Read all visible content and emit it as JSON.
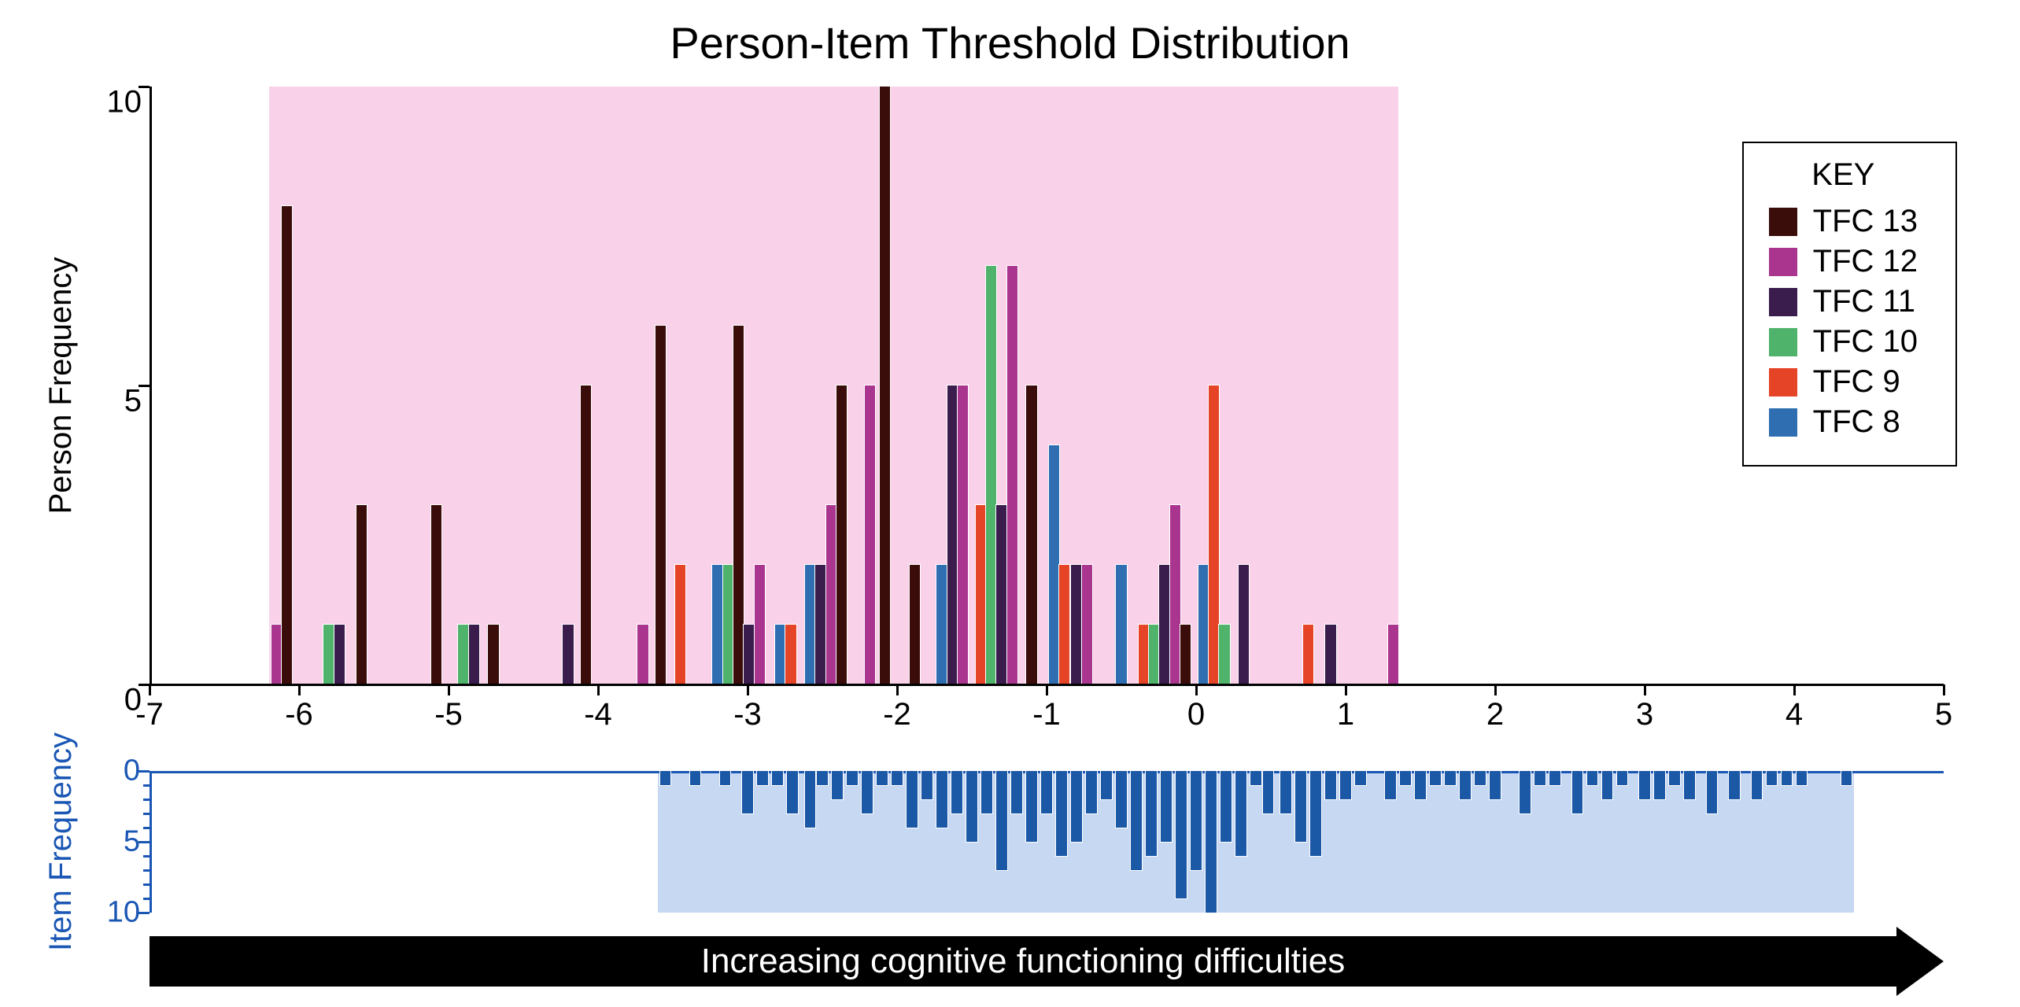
{
  "chart_data": {
    "type": "bar",
    "title": "Person-Item Threshold Distribution",
    "x_axis": {
      "range": [
        -7,
        5
      ],
      "ticks": [
        -7,
        -6,
        -5,
        -4,
        -3,
        -2,
        -1,
        0,
        1,
        2,
        3,
        4,
        5
      ]
    },
    "upper": {
      "ylabel": "Person Frequency",
      "ylim": [
        0,
        10
      ],
      "yticks": [
        0,
        5,
        10
      ],
      "pink_band_range": [
        -6.2,
        1.35
      ],
      "series": [
        {
          "name": "TFC 13",
          "color": "#3b0d0a"
        },
        {
          "name": "TFC 12",
          "color": "#a9358f"
        },
        {
          "name": "TFC 11",
          "color": "#3b1d4d"
        },
        {
          "name": "TFC 10",
          "color": "#4fb36c"
        },
        {
          "name": "TFC 9",
          "color": "#e64427"
        },
        {
          "name": "TFC 8",
          "color": "#2f6fb1"
        }
      ],
      "bar_width": 0.07,
      "bars": [
        {
          "x": -6.15,
          "y": 1,
          "series": "TFC 12"
        },
        {
          "x": -6.08,
          "y": 8,
          "series": "TFC 13"
        },
        {
          "x": -5.8,
          "y": 1,
          "series": "TFC 10"
        },
        {
          "x": -5.73,
          "y": 1,
          "series": "TFC 11"
        },
        {
          "x": -5.58,
          "y": 3,
          "series": "TFC 13"
        },
        {
          "x": -5.08,
          "y": 3,
          "series": "TFC 13"
        },
        {
          "x": -4.9,
          "y": 1,
          "series": "TFC 10"
        },
        {
          "x": -4.83,
          "y": 1,
          "series": "TFC 11"
        },
        {
          "x": -4.7,
          "y": 1,
          "series": "TFC 13"
        },
        {
          "x": -4.2,
          "y": 1,
          "series": "TFC 11"
        },
        {
          "x": -4.08,
          "y": 5,
          "series": "TFC 13"
        },
        {
          "x": -3.7,
          "y": 1,
          "series": "TFC 12"
        },
        {
          "x": -3.58,
          "y": 6,
          "series": "TFC 13"
        },
        {
          "x": -3.45,
          "y": 2,
          "series": "TFC 9"
        },
        {
          "x": -3.2,
          "y": 2,
          "series": "TFC 8"
        },
        {
          "x": -3.13,
          "y": 2,
          "series": "TFC 10"
        },
        {
          "x": -3.06,
          "y": 6,
          "series": "TFC 13"
        },
        {
          "x": -2.99,
          "y": 1,
          "series": "TFC 11"
        },
        {
          "x": -2.92,
          "y": 2,
          "series": "TFC 12"
        },
        {
          "x": -2.78,
          "y": 1,
          "series": "TFC 8"
        },
        {
          "x": -2.71,
          "y": 1,
          "series": "TFC 9"
        },
        {
          "x": -2.58,
          "y": 2,
          "series": "TFC 8"
        },
        {
          "x": -2.51,
          "y": 2,
          "series": "TFC 11"
        },
        {
          "x": -2.44,
          "y": 3,
          "series": "TFC 12"
        },
        {
          "x": -2.37,
          "y": 5,
          "series": "TFC 13"
        },
        {
          "x": -2.18,
          "y": 5,
          "series": "TFC 12"
        },
        {
          "x": -2.08,
          "y": 10,
          "series": "TFC 13"
        },
        {
          "x": -1.88,
          "y": 2,
          "series": "TFC 13"
        },
        {
          "x": -1.7,
          "y": 2,
          "series": "TFC 8"
        },
        {
          "x": -1.63,
          "y": 5,
          "series": "TFC 11"
        },
        {
          "x": -1.56,
          "y": 5,
          "series": "TFC 12"
        },
        {
          "x": -1.44,
          "y": 3,
          "series": "TFC 9"
        },
        {
          "x": -1.37,
          "y": 7,
          "series": "TFC 10"
        },
        {
          "x": -1.3,
          "y": 3,
          "series": "TFC 11"
        },
        {
          "x": -1.23,
          "y": 7,
          "series": "TFC 12"
        },
        {
          "x": -1.1,
          "y": 5,
          "series": "TFC 13"
        },
        {
          "x": -0.95,
          "y": 4,
          "series": "TFC 8"
        },
        {
          "x": -0.88,
          "y": 2,
          "series": "TFC 9"
        },
        {
          "x": -0.8,
          "y": 2,
          "series": "TFC 11"
        },
        {
          "x": -0.73,
          "y": 2,
          "series": "TFC 12"
        },
        {
          "x": -0.5,
          "y": 2,
          "series": "TFC 8"
        },
        {
          "x": -0.35,
          "y": 1,
          "series": "TFC 9"
        },
        {
          "x": -0.28,
          "y": 1,
          "series": "TFC 10"
        },
        {
          "x": -0.21,
          "y": 2,
          "series": "TFC 11"
        },
        {
          "x": -0.14,
          "y": 3,
          "series": "TFC 12"
        },
        {
          "x": -0.07,
          "y": 1,
          "series": "TFC 13"
        },
        {
          "x": 0.05,
          "y": 2,
          "series": "TFC 8"
        },
        {
          "x": 0.12,
          "y": 5,
          "series": "TFC 9"
        },
        {
          "x": 0.19,
          "y": 1,
          "series": "TFC 10"
        },
        {
          "x": 0.32,
          "y": 2,
          "series": "TFC 11"
        },
        {
          "x": 0.75,
          "y": 1,
          "series": "TFC 9"
        },
        {
          "x": 0.9,
          "y": 1,
          "series": "TFC 11"
        },
        {
          "x": 1.32,
          "y": 1,
          "series": "TFC 12"
        }
      ]
    },
    "lower": {
      "ylabel": "Item Frequency",
      "ylim": [
        0,
        10
      ],
      "yticks": [
        0,
        5,
        10
      ],
      "blue_band_range": [
        -3.6,
        4.4
      ],
      "bar_color": "#1b58a6",
      "bar_width": 0.07,
      "bars": [
        {
          "x": -3.55,
          "y": 1
        },
        {
          "x": -3.35,
          "y": 1
        },
        {
          "x": -3.15,
          "y": 1
        },
        {
          "x": -3.0,
          "y": 3
        },
        {
          "x": -2.9,
          "y": 1
        },
        {
          "x": -2.8,
          "y": 1
        },
        {
          "x": -2.7,
          "y": 3
        },
        {
          "x": -2.58,
          "y": 4
        },
        {
          "x": -2.5,
          "y": 1
        },
        {
          "x": -2.4,
          "y": 2
        },
        {
          "x": -2.3,
          "y": 1
        },
        {
          "x": -2.2,
          "y": 3
        },
        {
          "x": -2.1,
          "y": 1
        },
        {
          "x": -2.0,
          "y": 1
        },
        {
          "x": -1.9,
          "y": 4
        },
        {
          "x": -1.8,
          "y": 2
        },
        {
          "x": -1.7,
          "y": 4
        },
        {
          "x": -1.6,
          "y": 3
        },
        {
          "x": -1.5,
          "y": 5
        },
        {
          "x": -1.4,
          "y": 3
        },
        {
          "x": -1.3,
          "y": 7
        },
        {
          "x": -1.2,
          "y": 3
        },
        {
          "x": -1.1,
          "y": 5
        },
        {
          "x": -1.0,
          "y": 3
        },
        {
          "x": -0.9,
          "y": 6
        },
        {
          "x": -0.8,
          "y": 5
        },
        {
          "x": -0.7,
          "y": 3
        },
        {
          "x": -0.6,
          "y": 2
        },
        {
          "x": -0.5,
          "y": 4
        },
        {
          "x": -0.4,
          "y": 7
        },
        {
          "x": -0.3,
          "y": 6
        },
        {
          "x": -0.2,
          "y": 5
        },
        {
          "x": -0.1,
          "y": 9
        },
        {
          "x": 0.0,
          "y": 7
        },
        {
          "x": 0.1,
          "y": 11
        },
        {
          "x": 0.2,
          "y": 5
        },
        {
          "x": 0.3,
          "y": 6
        },
        {
          "x": 0.4,
          "y": 1
        },
        {
          "x": 0.48,
          "y": 3
        },
        {
          "x": 0.6,
          "y": 3
        },
        {
          "x": 0.7,
          "y": 5
        },
        {
          "x": 0.8,
          "y": 6
        },
        {
          "x": 0.9,
          "y": 2
        },
        {
          "x": 1.0,
          "y": 2
        },
        {
          "x": 1.1,
          "y": 1
        },
        {
          "x": 1.3,
          "y": 2
        },
        {
          "x": 1.4,
          "y": 1
        },
        {
          "x": 1.5,
          "y": 2
        },
        {
          "x": 1.6,
          "y": 1
        },
        {
          "x": 1.7,
          "y": 1
        },
        {
          "x": 1.8,
          "y": 2
        },
        {
          "x": 1.9,
          "y": 1
        },
        {
          "x": 2.0,
          "y": 2
        },
        {
          "x": 2.2,
          "y": 3
        },
        {
          "x": 2.3,
          "y": 1
        },
        {
          "x": 2.4,
          "y": 1
        },
        {
          "x": 2.55,
          "y": 3
        },
        {
          "x": 2.65,
          "y": 1
        },
        {
          "x": 2.75,
          "y": 2
        },
        {
          "x": 2.85,
          "y": 1
        },
        {
          "x": 3.0,
          "y": 2
        },
        {
          "x": 3.1,
          "y": 2
        },
        {
          "x": 3.2,
          "y": 1
        },
        {
          "x": 3.3,
          "y": 2
        },
        {
          "x": 3.45,
          "y": 3
        },
        {
          "x": 3.6,
          "y": 2
        },
        {
          "x": 3.75,
          "y": 2
        },
        {
          "x": 3.85,
          "y": 1
        },
        {
          "x": 3.95,
          "y": 1
        },
        {
          "x": 4.05,
          "y": 1
        },
        {
          "x": 4.35,
          "y": 1
        }
      ]
    },
    "arrow_label": "Increasing cognitive functioning difficulties",
    "legend_title": "KEY"
  }
}
